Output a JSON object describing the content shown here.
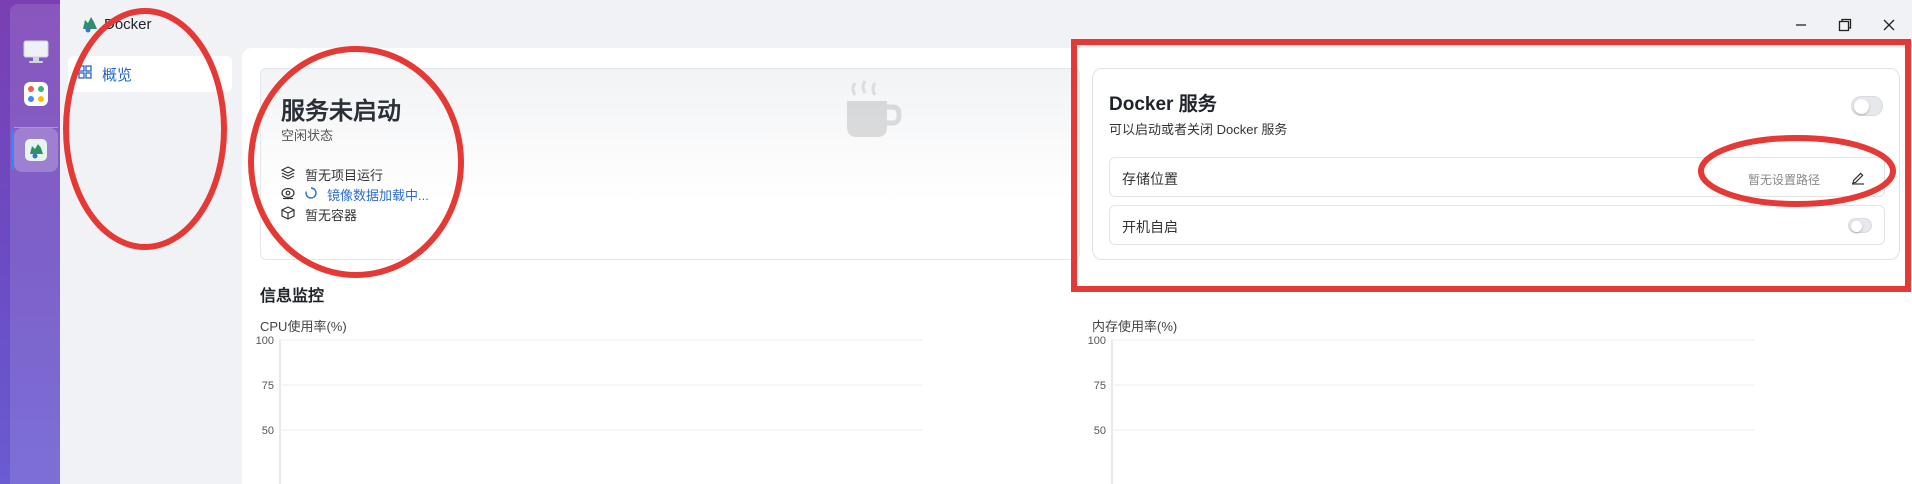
{
  "window": {
    "title": "Docker"
  },
  "sidebar": {
    "items": [
      {
        "label": "概览",
        "icon": "grid-icon"
      }
    ]
  },
  "status": {
    "title": "服务未启动",
    "subtitle": "空闲状态",
    "projects": "暂无项目运行",
    "images": "镜像数据加载中...",
    "containers": "暂无容器"
  },
  "monitor": {
    "title": "信息监控",
    "cpu_label": "CPU使用率(%)",
    "mem_label": "内存使用率(%)"
  },
  "service": {
    "title": "Docker 服务",
    "subtitle": "可以启动或者关闭 Docker 服务",
    "enabled": false,
    "storage_label": "存储位置",
    "storage_placeholder": "暂无设置路径",
    "autostart_label": "开机自启",
    "autostart_enabled": false
  },
  "chart_data": [
    {
      "type": "line",
      "title": "CPU使用率(%)",
      "ylim": [
        0,
        100
      ],
      "y_ticks": [
        "100",
        "75",
        "50"
      ],
      "series": []
    },
    {
      "type": "line",
      "title": "内存使用率(%)",
      "ylim": [
        0,
        100
      ],
      "y_ticks": [
        "100",
        "75",
        "50"
      ],
      "series": []
    }
  ],
  "colors": {
    "accent": "#2563c9",
    "annotation": "#e53935",
    "dock_top": "#7a3fb3",
    "dock_bottom": "#6a5cd1"
  }
}
